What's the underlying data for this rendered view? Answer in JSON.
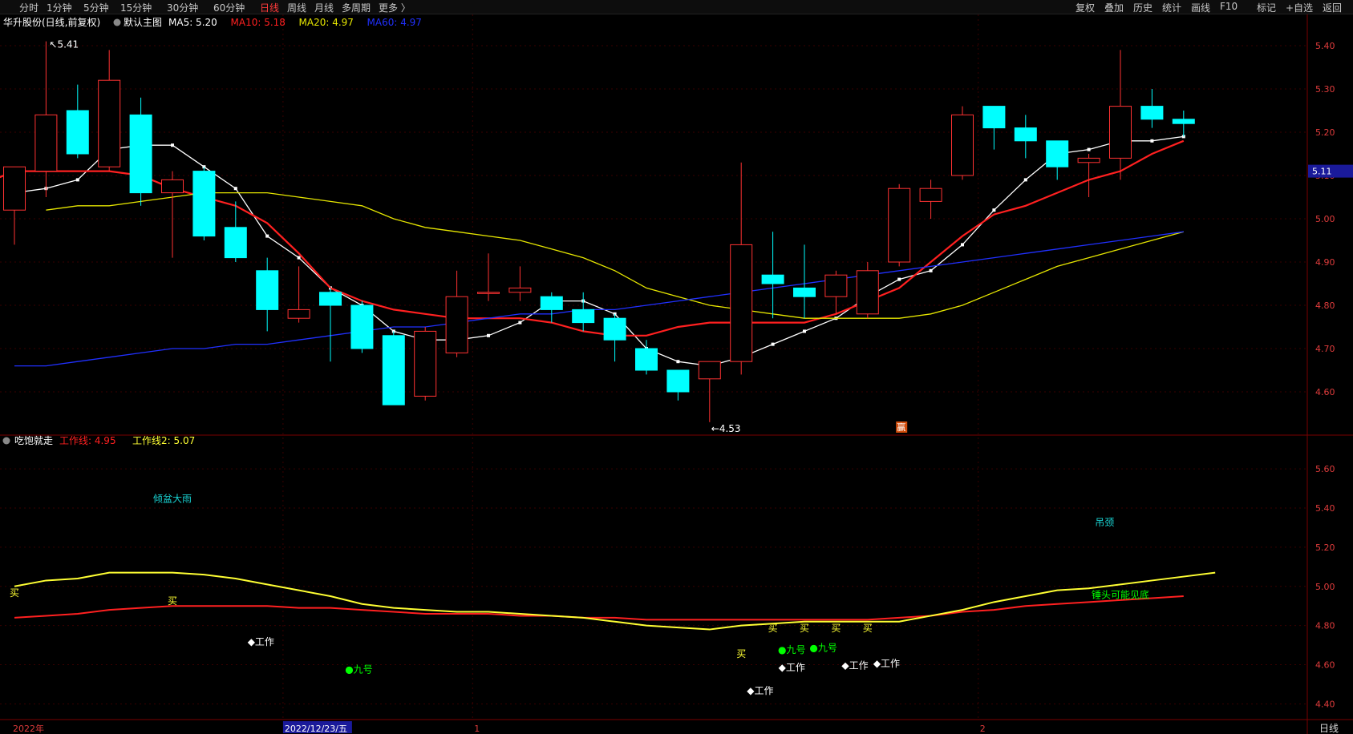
{
  "toolbar": {
    "left_items": [
      {
        "label": "分时",
        "active": false
      },
      {
        "label": "1分钟",
        "active": false
      },
      {
        "label": "5分钟",
        "active": false
      },
      {
        "label": "15分钟",
        "active": false
      },
      {
        "label": "30分钟",
        "active": false
      },
      {
        "label": "60分钟",
        "active": false
      },
      {
        "label": "日线",
        "active": true
      },
      {
        "label": "周线",
        "active": false
      },
      {
        "label": "月线",
        "active": false
      },
      {
        "label": "多周期",
        "active": false
      },
      {
        "label": "更多 〉",
        "active": false
      }
    ],
    "right_items": [
      "复权",
      "叠加",
      "历史",
      "统计",
      "画线",
      "F10",
      "标记",
      "+自选",
      "返回"
    ]
  },
  "colors": {
    "up": "#ff3232",
    "down": "#00ffff",
    "ma5": "#ffffff",
    "ma10": "#ff2020",
    "ma20": "#e6e600",
    "ma60": "#2030ff",
    "grid": "#3a0000",
    "border": "#7a0000",
    "axis_text": "#e03c3c",
    "work_line": "#ff2020",
    "work_line2": "#ffff33"
  },
  "main_panel": {
    "title": "华升股份(日线,前复权)",
    "indicator_name": "默认主图",
    "legend": [
      {
        "label": "MA5: 5.20",
        "color": "#ffffff"
      },
      {
        "label": "MA10: 5.18",
        "color": "#ff2020"
      },
      {
        "label": "MA20: 4.97",
        "color": "#e6e600"
      },
      {
        "label": "MA60: 4.97",
        "color": "#2030ff"
      }
    ],
    "high_label": "5.41",
    "low_label": "4.53",
    "current_price": "5.11",
    "special_marker": "赢"
  },
  "sub_panel": {
    "indicator_name": "吃饱就走",
    "legend": [
      {
        "label": "工作线: 4.95",
        "color": "#ff2020"
      },
      {
        "label": "工作线2: 5.07",
        "color": "#ffff33"
      }
    ]
  },
  "x_axis": {
    "labels": [
      {
        "text": "2022年",
        "index": 0
      },
      {
        "text": "2022/12/23/五",
        "index": 9
      },
      {
        "text": "1",
        "index": 15
      },
      {
        "text": "2",
        "index": 31
      }
    ],
    "period": "日线"
  },
  "chart_data": [
    {
      "type": "candlestick",
      "title": "华升股份(日线,前复权)",
      "ylim": [
        4.5,
        5.45
      ],
      "yticks": [
        4.6,
        4.7,
        4.8,
        4.9,
        5.0,
        5.1,
        5.2,
        5.3,
        5.4
      ],
      "candles": [
        {
          "o": 5.02,
          "h": 5.12,
          "l": 4.94,
          "c": 5.12
        },
        {
          "o": 5.11,
          "h": 5.41,
          "l": 5.05,
          "c": 5.24
        },
        {
          "o": 5.25,
          "h": 5.31,
          "l": 5.14,
          "c": 5.15
        },
        {
          "o": 5.12,
          "h": 5.39,
          "l": 5.11,
          "c": 5.32
        },
        {
          "o": 5.24,
          "h": 5.28,
          "l": 5.03,
          "c": 5.06
        },
        {
          "o": 5.06,
          "h": 5.11,
          "l": 4.91,
          "c": 5.09
        },
        {
          "o": 5.11,
          "h": 5.12,
          "l": 4.95,
          "c": 4.96
        },
        {
          "o": 4.98,
          "h": 5.04,
          "l": 4.9,
          "c": 4.91
        },
        {
          "o": 4.88,
          "h": 4.91,
          "l": 4.74,
          "c": 4.79
        },
        {
          "o": 4.77,
          "h": 4.89,
          "l": 4.76,
          "c": 4.79
        },
        {
          "o": 4.83,
          "h": 4.84,
          "l": 4.67,
          "c": 4.8
        },
        {
          "o": 4.8,
          "h": 4.81,
          "l": 4.69,
          "c": 4.7
        },
        {
          "o": 4.73,
          "h": 4.74,
          "l": 4.57,
          "c": 4.57
        },
        {
          "o": 4.59,
          "h": 4.75,
          "l": 4.58,
          "c": 4.74
        },
        {
          "o": 4.69,
          "h": 4.88,
          "l": 4.68,
          "c": 4.82
        },
        {
          "o": 4.83,
          "h": 4.92,
          "l": 4.81,
          "c": 4.83
        },
        {
          "o": 4.83,
          "h": 4.89,
          "l": 4.81,
          "c": 4.84
        },
        {
          "o": 4.82,
          "h": 4.83,
          "l": 4.76,
          "c": 4.79
        },
        {
          "o": 4.79,
          "h": 4.83,
          "l": 4.74,
          "c": 4.76
        },
        {
          "o": 4.77,
          "h": 4.78,
          "l": 4.67,
          "c": 4.72
        },
        {
          "o": 4.7,
          "h": 4.72,
          "l": 4.64,
          "c": 4.65
        },
        {
          "o": 4.65,
          "h": 4.65,
          "l": 4.58,
          "c": 4.6
        },
        {
          "o": 4.63,
          "h": 4.67,
          "l": 4.53,
          "c": 4.67
        },
        {
          "o": 4.67,
          "h": 5.13,
          "l": 4.64,
          "c": 4.94
        },
        {
          "o": 4.87,
          "h": 4.97,
          "l": 4.77,
          "c": 4.85
        },
        {
          "o": 4.84,
          "h": 4.94,
          "l": 4.77,
          "c": 4.82
        },
        {
          "o": 4.82,
          "h": 4.88,
          "l": 4.78,
          "c": 4.87
        },
        {
          "o": 4.78,
          "h": 4.9,
          "l": 4.77,
          "c": 4.88
        },
        {
          "o": 4.9,
          "h": 5.08,
          "l": 4.89,
          "c": 5.07
        },
        {
          "o": 5.04,
          "h": 5.09,
          "l": 5.0,
          "c": 5.07
        },
        {
          "o": 5.1,
          "h": 5.26,
          "l": 5.09,
          "c": 5.24
        },
        {
          "o": 5.26,
          "h": 5.26,
          "l": 5.16,
          "c": 5.21
        },
        {
          "o": 5.21,
          "h": 5.24,
          "l": 5.14,
          "c": 5.18
        },
        {
          "o": 5.18,
          "h": 5.18,
          "l": 5.09,
          "c": 5.12
        },
        {
          "o": 5.13,
          "h": 5.15,
          "l": 5.05,
          "c": 5.14
        },
        {
          "o": 5.14,
          "h": 5.39,
          "l": 5.09,
          "c": 5.26
        },
        {
          "o": 5.26,
          "h": 5.3,
          "l": 5.21,
          "c": 5.23
        },
        {
          "o": 5.23,
          "h": 5.25,
          "l": 5.19,
          "c": 5.22
        }
      ],
      "series": [
        {
          "name": "MA5",
          "values": [
            5.06,
            5.07,
            5.09,
            5.16,
            5.17,
            5.17,
            5.12,
            5.07,
            4.96,
            4.91,
            4.84,
            4.8,
            4.74,
            4.72,
            4.72,
            4.73,
            4.76,
            4.81,
            4.81,
            4.78,
            4.7,
            4.67,
            4.66,
            4.68,
            4.71,
            4.74,
            4.77,
            4.82,
            4.86,
            4.88,
            4.94,
            5.02,
            5.09,
            5.15,
            5.16,
            5.18,
            5.18,
            5.19
          ]
        },
        {
          "name": "MA10",
          "values": [
            5.03,
            5.06,
            5.08,
            5.11,
            5.11,
            5.11,
            5.11,
            5.1,
            5.07,
            5.05,
            5.03,
            4.99,
            4.92,
            4.84,
            4.81,
            4.79,
            4.78,
            4.77,
            4.77,
            4.77,
            4.76,
            4.74,
            4.73,
            4.73,
            4.75,
            4.76,
            4.76,
            4.76,
            4.76,
            4.78,
            4.81,
            4.84,
            4.9,
            4.96,
            5.01,
            5.03,
            5.06,
            5.09,
            5.11,
            5.15,
            5.18
          ]
        },
        {
          "name": "MA20",
          "values": [
            5.02,
            5.03,
            5.03,
            5.04,
            5.05,
            5.06,
            5.06,
            5.06,
            5.05,
            5.04,
            5.03,
            5.0,
            4.98,
            4.97,
            4.96,
            4.95,
            4.93,
            4.91,
            4.88,
            4.84,
            4.82,
            4.8,
            4.79,
            4.78,
            4.77,
            4.77,
            4.77,
            4.77,
            4.78,
            4.8,
            4.83,
            4.86,
            4.89,
            4.91,
            4.93,
            4.95,
            4.97
          ]
        },
        {
          "name": "MA60",
          "values": [
            4.66,
            4.66,
            4.67,
            4.68,
            4.69,
            4.7,
            4.7,
            4.71,
            4.71,
            4.72,
            4.73,
            4.74,
            4.75,
            4.75,
            4.76,
            4.77,
            4.78,
            4.78,
            4.79,
            4.79,
            4.8,
            4.81,
            4.82,
            4.83,
            4.84,
            4.85,
            4.86,
            4.87,
            4.88,
            4.89,
            4.9,
            4.91,
            4.92,
            4.93,
            4.94,
            4.95,
            4.96,
            4.97
          ]
        }
      ]
    },
    {
      "type": "line",
      "title": "吃饱就走",
      "ylim": [
        4.32,
        5.76
      ],
      "yticks": [
        4.4,
        4.6,
        4.8,
        5.0,
        5.2,
        5.4,
        5.6
      ],
      "series": [
        {
          "name": "工作线",
          "values": [
            4.84,
            4.85,
            4.86,
            4.88,
            4.89,
            4.9,
            4.9,
            4.9,
            4.9,
            4.89,
            4.89,
            4.88,
            4.87,
            4.86,
            4.86,
            4.86,
            4.85,
            4.85,
            4.84,
            4.84,
            4.83,
            4.83,
            4.83,
            4.83,
            4.83,
            4.83,
            4.83,
            4.83,
            4.84,
            4.85,
            4.87,
            4.88,
            4.9,
            4.91,
            4.92,
            4.93,
            4.94,
            4.95
          ]
        },
        {
          "name": "工作线2",
          "values": [
            5.0,
            5.03,
            5.04,
            5.07,
            5.07,
            5.07,
            5.06,
            5.04,
            5.01,
            4.98,
            4.95,
            4.91,
            4.89,
            4.88,
            4.87,
            4.87,
            4.86,
            4.85,
            4.84,
            4.82,
            4.8,
            4.79,
            4.78,
            4.8,
            4.81,
            4.82,
            4.82,
            4.82,
            4.82,
            4.85,
            4.88,
            4.92,
            4.95,
            4.98,
            4.99,
            5.01,
            5.03,
            5.05,
            5.07
          ]
        }
      ],
      "annotations": [
        {
          "text": "倾盆大雨",
          "index": 5,
          "y": 5.43,
          "color": "#19d1d1"
        },
        {
          "text": "买",
          "index": 0,
          "y": 4.95,
          "color": "#ffff33"
        },
        {
          "text": "买",
          "index": 5,
          "y": 4.91,
          "color": "#ffff33"
        },
        {
          "text": "◆工作",
          "index": 7.8,
          "y": 4.7,
          "color": "#ffffff"
        },
        {
          "text": "●九号",
          "index": 10.9,
          "y": 4.56,
          "color": "#00ff00"
        },
        {
          "text": "买",
          "index": 24,
          "y": 4.77,
          "color": "#ffff33"
        },
        {
          "text": "买",
          "index": 23,
          "y": 4.64,
          "color": "#ffff33"
        },
        {
          "text": "买",
          "index": 25,
          "y": 4.77,
          "color": "#ffff33"
        },
        {
          "text": "买",
          "index": 26,
          "y": 4.77,
          "color": "#ffff33"
        },
        {
          "text": "买",
          "index": 27,
          "y": 4.77,
          "color": "#ffff33"
        },
        {
          "text": "●九号",
          "index": 24.6,
          "y": 4.66,
          "color": "#00ff00"
        },
        {
          "text": "●九号",
          "index": 25.6,
          "y": 4.67,
          "color": "#00ff00"
        },
        {
          "text": "◆工作",
          "index": 24.6,
          "y": 4.57,
          "color": "#ffffff"
        },
        {
          "text": "◆工作",
          "index": 23.6,
          "y": 4.45,
          "color": "#ffffff"
        },
        {
          "text": "◆工作",
          "index": 26.6,
          "y": 4.58,
          "color": "#ffffff"
        },
        {
          "text": "◆工作",
          "index": 27.6,
          "y": 4.59,
          "color": "#ffffff"
        },
        {
          "text": "吊颈",
          "index": 34.5,
          "y": 5.31,
          "color": "#19d1d1"
        },
        {
          "text": "锤头可能见底",
          "index": 35,
          "y": 4.94,
          "color": "#00ff00"
        }
      ]
    }
  ]
}
